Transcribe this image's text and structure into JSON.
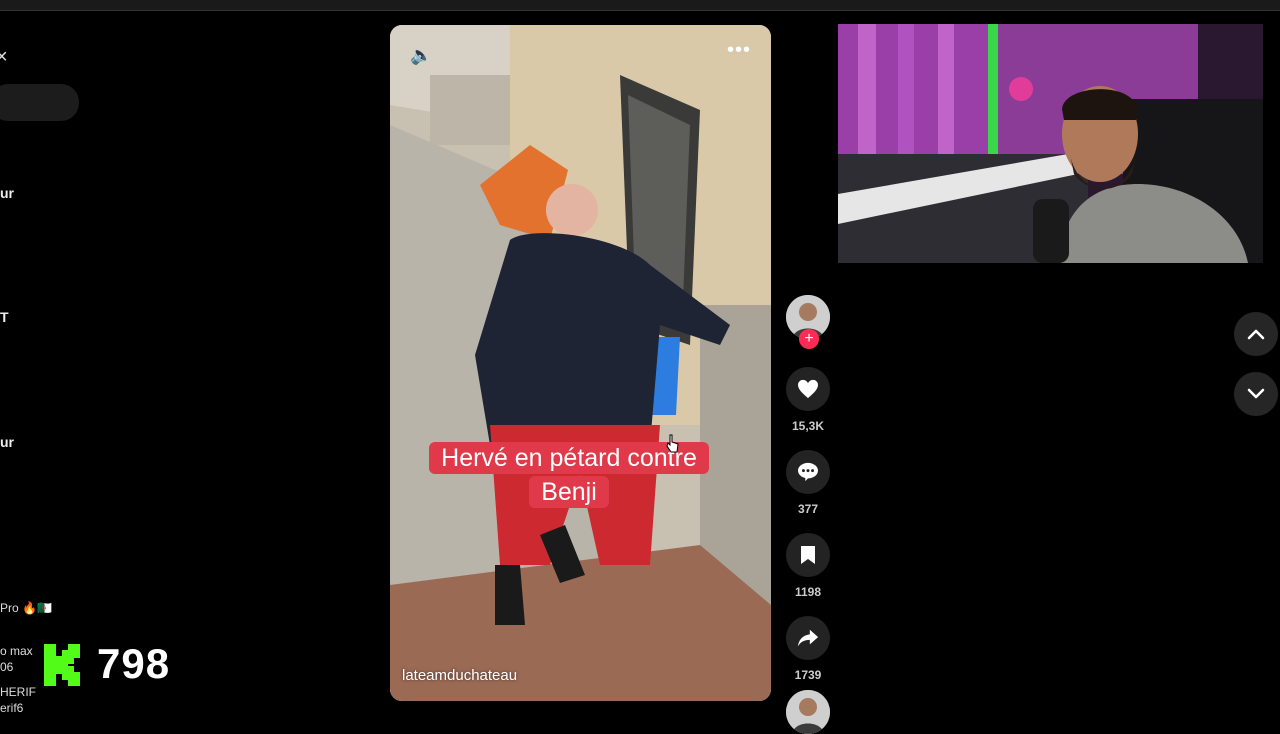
{
  "sidebar": {
    "close_glyph": "K",
    "items": [
      "ur",
      "T",
      "ur"
    ],
    "chat": [
      {
        "name": "Pro 🔥🇩🇿",
        "handle": ""
      },
      {
        "name": "o max",
        "handle": "06"
      },
      {
        "name": "HERIF",
        "handle": "erif6"
      }
    ]
  },
  "kick": {
    "logo": "K",
    "viewer_count": "798",
    "brand_color": "#53fc18"
  },
  "video": {
    "volume_icon": "🔈",
    "more_icon": "•••",
    "caption_line1": "Hervé en pétard contre",
    "caption_line2": "Benji",
    "handle": "lateamduchateau",
    "caption_color": "#e0394a"
  },
  "actions": {
    "likes": "15,3K",
    "comments": "377",
    "saves": "1198",
    "shares": "1739",
    "plus_color": "#fe2c55"
  }
}
